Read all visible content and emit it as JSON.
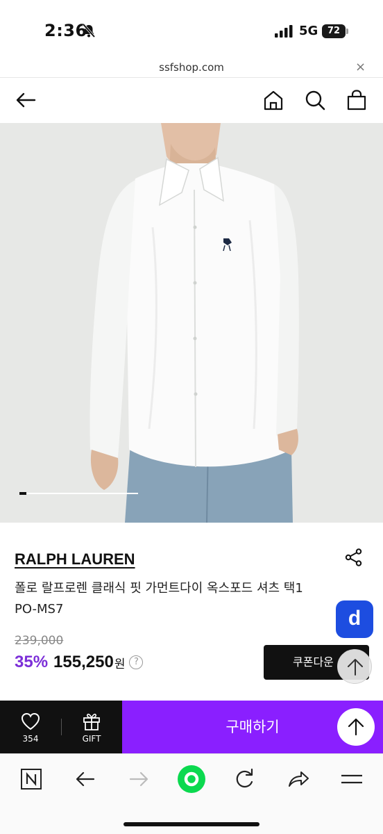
{
  "status_bar": {
    "time": "2:36",
    "network": "5G",
    "battery": "72"
  },
  "browser": {
    "url": "ssfshop.com",
    "close_symbol": "×"
  },
  "site_nav": {
    "icons": [
      "back-arrow-icon",
      "home-icon",
      "search-icon",
      "shopping-bag-icon"
    ]
  },
  "gallery": {
    "progress": 0.06
  },
  "product": {
    "brand": "RALPH LAUREN",
    "name": "폴로 랄프로렌 클래식 핏 가먼트다이 옥스포드 셔츠 택1 PO-MS7",
    "original_price": "239,000",
    "discount": "35%",
    "price": "155,250",
    "currency": "원",
    "help_symbol": "?"
  },
  "buttons": {
    "coupon": "쿠폰다운",
    "d_badge": "d",
    "buy": "구매하기"
  },
  "actions": {
    "like_count": "354",
    "gift_label": "GIFT"
  },
  "toolbar": {
    "icons": [
      "naver-n-icon",
      "back-icon",
      "forward-icon",
      "green-home-icon",
      "reload-icon",
      "share-icon",
      "menu-icon"
    ]
  },
  "colors": {
    "accent_purple": "#8a1fff",
    "discount_purple": "#7c2fd8",
    "badge_blue": "#1d4de0",
    "dark": "#111111",
    "green": "#0bd94f"
  }
}
